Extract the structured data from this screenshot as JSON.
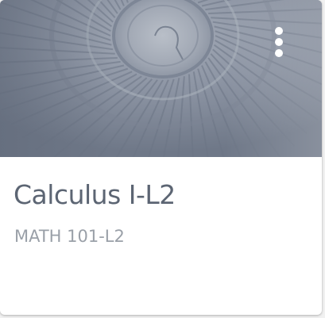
{
  "course_card": {
    "title": "Calculus I-L2",
    "code": "MATH 101-L2",
    "banner_image": "spiral-staircase",
    "menu_icon": "more-vertical-icon"
  },
  "colors": {
    "banner_tint": "#8a93a3",
    "title_text": "#5c6573",
    "code_text": "#9aa0a8",
    "card_background": "#ffffff"
  }
}
